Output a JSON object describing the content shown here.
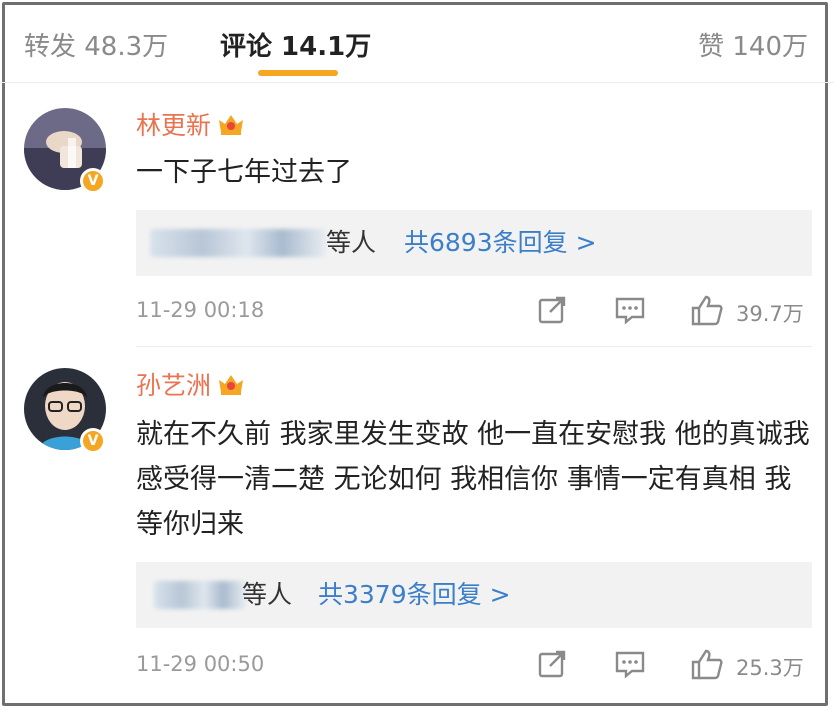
{
  "tabs": {
    "repost": "转发 48.3万",
    "comments": "评论 14.1万",
    "likes": "赞 140万"
  },
  "comments": [
    {
      "name": "林更新",
      "content": "一下子七年过去了",
      "replies_others": "等人",
      "replies_count": "共6893条回复 >",
      "time": "11-29 00:18",
      "likes": "39.7万"
    },
    {
      "name": "孙艺洲",
      "content": "就在不久前 我家里发生变故 他一直在安慰我 他的真诚我感受得一清二楚 无论如何 我相信你 事情一定有真相 我等你归来",
      "replies_others": "等人",
      "replies_count": "共3379条回复 >",
      "time": "11-29 00:50",
      "likes": "25.3万"
    }
  ],
  "colors": {
    "accent": "#f5a623",
    "name": "#eb7350",
    "link": "#3b7ec9"
  }
}
